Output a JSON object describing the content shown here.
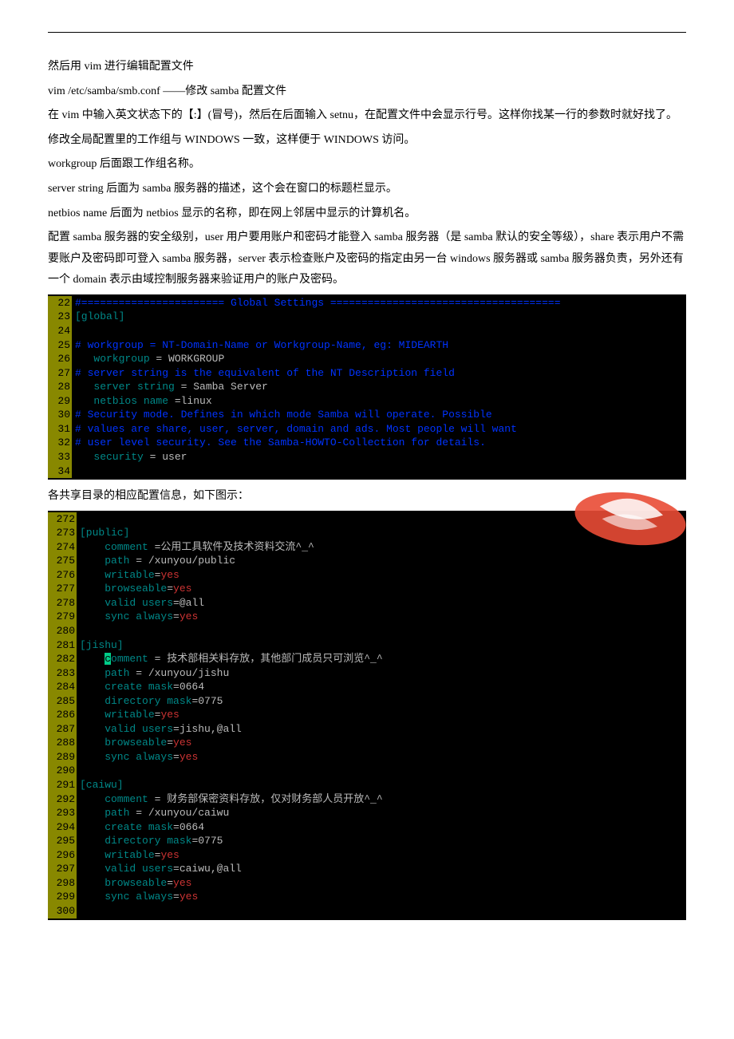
{
  "para": {
    "p1": "然后用 vim 进行编辑配置文件",
    "p2": "vim /etc/samba/smb.conf  ——修改 samba 配置文件",
    "p3": "在 vim 中输入英文状态下的【:】(冒号)，然后在后面输入 setnu，在配置文件中会显示行号。这样你找某一行的参数时就好找了。",
    "p4": "修改全局配置里的工作组与 WINDOWS 一致，这样便于 WINDOWS 访问。",
    "p5": "workgroup 后面跟工作组名称。",
    "p6": "server string 后面为 samba 服务器的描述，这个会在窗口的标题栏显示。",
    "p7": "netbios name 后面为 netbios 显示的名称，即在网上邻居中显示的计算机名。",
    "p8": "配置 samba 服务器的安全级别，user 用户要用账户和密码才能登入 samba 服务器（是 samba 默认的安全等级），share 表示用户不需要账户及密码即可登入 samba 服务器，server 表示检查账户及密码的指定由另一台 windows 服务器或 samba 服务器负责，另外还有一个 domain 表示由域控制服务器来验证用户的账户及密码。"
  },
  "caption2": "各共享目录的相应配置信息，如下图示：",
  "block1": [
    {
      "n": "22",
      "seg": [
        {
          "t": "#======================= Global Settings =====================================",
          "cls": "c-comment"
        }
      ]
    },
    {
      "n": "23",
      "seg": [
        {
          "t": "[global]",
          "cls": "c-section"
        }
      ]
    },
    {
      "n": "24",
      "seg": [
        {
          "t": " ",
          "cls": "c-val"
        }
      ]
    },
    {
      "n": "25",
      "seg": [
        {
          "t": "# workgroup = NT-Domain-Name or Workgroup-Name, eg: MIDEARTH",
          "cls": "c-comment"
        }
      ]
    },
    {
      "n": "26",
      "seg": [
        {
          "t": "   workgroup",
          "cls": "c-key"
        },
        {
          "t": " = WORKGROUP",
          "cls": "c-val"
        }
      ]
    },
    {
      "n": "27",
      "seg": [
        {
          "t": "# server string is the equivalent of the NT Description field",
          "cls": "c-comment"
        }
      ]
    },
    {
      "n": "28",
      "seg": [
        {
          "t": "   server string",
          "cls": "c-key"
        },
        {
          "t": " = Samba Server",
          "cls": "c-val"
        }
      ]
    },
    {
      "n": "29",
      "seg": [
        {
          "t": "   netbios name",
          "cls": "c-key"
        },
        {
          "t": " =linux",
          "cls": "c-val"
        }
      ]
    },
    {
      "n": "30",
      "seg": [
        {
          "t": "# Security mode. Defines in which mode Samba will operate. Possible",
          "cls": "c-comment"
        }
      ]
    },
    {
      "n": "31",
      "seg": [
        {
          "t": "# values are share, user, server, domain and ads. Most people will want",
          "cls": "c-comment"
        }
      ]
    },
    {
      "n": "32",
      "seg": [
        {
          "t": "# user level security. See the Samba-HOWTO-Collection for details.",
          "cls": "c-comment"
        }
      ]
    },
    {
      "n": "33",
      "seg": [
        {
          "t": "   security",
          "cls": "c-key"
        },
        {
          "t": " = user",
          "cls": "c-val"
        }
      ]
    },
    {
      "n": "34",
      "seg": [
        {
          "t": " ",
          "cls": "c-val"
        }
      ]
    }
  ],
  "block2": [
    {
      "n": "272",
      "seg": [
        {
          "t": " ",
          "cls": "c-val"
        }
      ]
    },
    {
      "n": "273",
      "seg": [
        {
          "t": "[public]",
          "cls": "c-section"
        }
      ]
    },
    {
      "n": "274",
      "seg": [
        {
          "t": "    comment",
          "cls": "c-key"
        },
        {
          "t": " =公用工具软件及技术资料交流^_^",
          "cls": "c-val"
        }
      ]
    },
    {
      "n": "275",
      "seg": [
        {
          "t": "    path",
          "cls": "c-key"
        },
        {
          "t": " = /xunyou/public",
          "cls": "c-val"
        }
      ]
    },
    {
      "n": "276",
      "seg": [
        {
          "t": "    writable",
          "cls": "c-key"
        },
        {
          "t": "=",
          "cls": "c-eq"
        },
        {
          "t": "yes",
          "cls": "c-valred"
        }
      ]
    },
    {
      "n": "277",
      "seg": [
        {
          "t": "    browseable",
          "cls": "c-key"
        },
        {
          "t": "=",
          "cls": "c-eq"
        },
        {
          "t": "yes",
          "cls": "c-valred"
        }
      ]
    },
    {
      "n": "278",
      "seg": [
        {
          "t": "    valid users",
          "cls": "c-key"
        },
        {
          "t": "=@all",
          "cls": "c-val"
        }
      ]
    },
    {
      "n": "279",
      "seg": [
        {
          "t": "    sync always",
          "cls": "c-key"
        },
        {
          "t": "=",
          "cls": "c-eq"
        },
        {
          "t": "yes",
          "cls": "c-valred"
        }
      ]
    },
    {
      "n": "280",
      "seg": [
        {
          "t": " ",
          "cls": "c-val"
        }
      ]
    },
    {
      "n": "281",
      "seg": [
        {
          "t": "[jishu]",
          "cls": "c-section"
        }
      ]
    },
    {
      "n": "282",
      "seg": [
        {
          "t": "    ",
          "cls": "c-val"
        },
        {
          "t": "c",
          "cls": "cursor-bg"
        },
        {
          "t": "omment",
          "cls": "c-key"
        },
        {
          "t": " = 技术部相关料存放，其他部门成员只可浏览^_^",
          "cls": "c-val"
        }
      ]
    },
    {
      "n": "283",
      "seg": [
        {
          "t": "    path",
          "cls": "c-key"
        },
        {
          "t": " = /xunyou/jishu",
          "cls": "c-val"
        }
      ]
    },
    {
      "n": "284",
      "seg": [
        {
          "t": "    create mask",
          "cls": "c-key"
        },
        {
          "t": "=0664",
          "cls": "c-val"
        }
      ]
    },
    {
      "n": "285",
      "seg": [
        {
          "t": "    directory mask",
          "cls": "c-key"
        },
        {
          "t": "=0775",
          "cls": "c-val"
        }
      ]
    },
    {
      "n": "286",
      "seg": [
        {
          "t": "    writable",
          "cls": "c-key"
        },
        {
          "t": "=",
          "cls": "c-eq"
        },
        {
          "t": "yes",
          "cls": "c-valred"
        }
      ]
    },
    {
      "n": "287",
      "seg": [
        {
          "t": "    valid users",
          "cls": "c-key"
        },
        {
          "t": "=jishu,@all",
          "cls": "c-val"
        }
      ]
    },
    {
      "n": "288",
      "seg": [
        {
          "t": "    browseable",
          "cls": "c-key"
        },
        {
          "t": "=",
          "cls": "c-eq"
        },
        {
          "t": "yes",
          "cls": "c-valred"
        }
      ]
    },
    {
      "n": "289",
      "seg": [
        {
          "t": "    sync always",
          "cls": "c-key"
        },
        {
          "t": "=",
          "cls": "c-eq"
        },
        {
          "t": "yes",
          "cls": "c-valred"
        }
      ]
    },
    {
      "n": "290",
      "seg": [
        {
          "t": " ",
          "cls": "c-val"
        }
      ]
    },
    {
      "n": "291",
      "seg": [
        {
          "t": "[caiwu]",
          "cls": "c-section"
        }
      ]
    },
    {
      "n": "292",
      "seg": [
        {
          "t": "    comment",
          "cls": "c-key"
        },
        {
          "t": " = 财务部保密资料存放，仅对财务部人员开放^_^",
          "cls": "c-val"
        }
      ]
    },
    {
      "n": "293",
      "seg": [
        {
          "t": "    path",
          "cls": "c-key"
        },
        {
          "t": " = /xunyou/caiwu",
          "cls": "c-val"
        }
      ]
    },
    {
      "n": "294",
      "seg": [
        {
          "t": "    create mask",
          "cls": "c-key"
        },
        {
          "t": "=0664",
          "cls": "c-val"
        }
      ]
    },
    {
      "n": "295",
      "seg": [
        {
          "t": "    directory mask",
          "cls": "c-key"
        },
        {
          "t": "=0775",
          "cls": "c-val"
        }
      ]
    },
    {
      "n": "296",
      "seg": [
        {
          "t": "    writable",
          "cls": "c-key"
        },
        {
          "t": "=",
          "cls": "c-eq"
        },
        {
          "t": "yes",
          "cls": "c-valred"
        }
      ]
    },
    {
      "n": "297",
      "seg": [
        {
          "t": "    valid users",
          "cls": "c-key"
        },
        {
          "t": "=caiwu,@all",
          "cls": "c-val"
        }
      ]
    },
    {
      "n": "298",
      "seg": [
        {
          "t": "    browseable",
          "cls": "c-key"
        },
        {
          "t": "=",
          "cls": "c-eq"
        },
        {
          "t": "yes",
          "cls": "c-valred"
        }
      ]
    },
    {
      "n": "299",
      "seg": [
        {
          "t": "    sync always",
          "cls": "c-key"
        },
        {
          "t": "=",
          "cls": "c-eq"
        },
        {
          "t": "yes",
          "cls": "c-valred"
        }
      ]
    },
    {
      "n": "300",
      "seg": [
        {
          "t": " ",
          "cls": "c-val"
        }
      ]
    }
  ]
}
